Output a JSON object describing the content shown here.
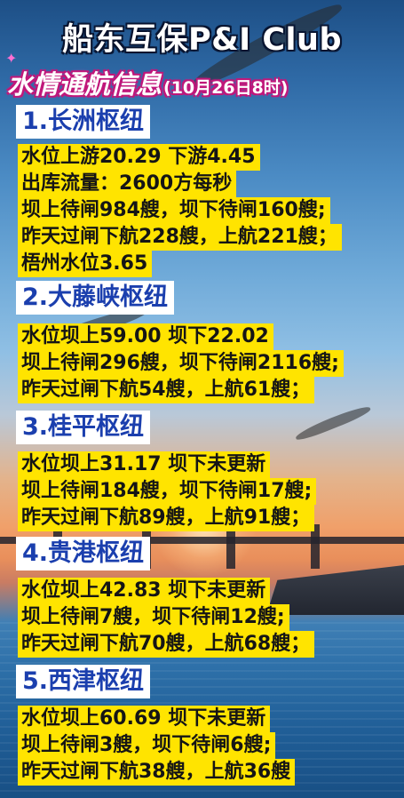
{
  "header": {
    "title": "船东互保P&I Club",
    "subtitle": "水情通航信息",
    "time": "(10月26日8时)"
  },
  "sections": [
    {
      "heading": "1.长洲枢纽",
      "lines": [
        "水位上游20.29  下游4.45",
        "出库流量：2600方每秒",
        "坝上待闸984艘，坝下待闸160艘;",
        "昨天过闸下航228艘，上航221艘；",
        "梧州水位3.65"
      ]
    },
    {
      "heading": "2.大藤峡枢纽",
      "lines": [
        "水位坝上59.00   坝下22.02",
        "坝上待闸296艘，坝下待闸2116艘;",
        "昨天过闸下航54艘，上航61艘；"
      ]
    },
    {
      "heading": "3.桂平枢纽",
      "lines": [
        "水位坝上31.17   坝下未更新",
        "坝上待闸184艘，坝下待闸17艘;",
        "昨天过闸下航89艘，上航91艘；"
      ]
    },
    {
      "heading": "4.贵港枢纽",
      "lines": [
        "水位坝上42.83   坝下未更新",
        "坝上待闸7艘，坝下待闸12艘;",
        "昨天过闸下航70艘，上航68艘；"
      ]
    },
    {
      "heading": "5.西津枢纽",
      "lines": [
        "水位坝上60.69   坝下未更新",
        "坝上待闸3艘，坝下待闸6艘;",
        "昨天过闸下航38艘，上航36艘"
      ]
    }
  ],
  "colors": {
    "highlight": "#ffe400",
    "heading_text": "#1b3fae",
    "subtitle_glow": "#c0177a"
  }
}
